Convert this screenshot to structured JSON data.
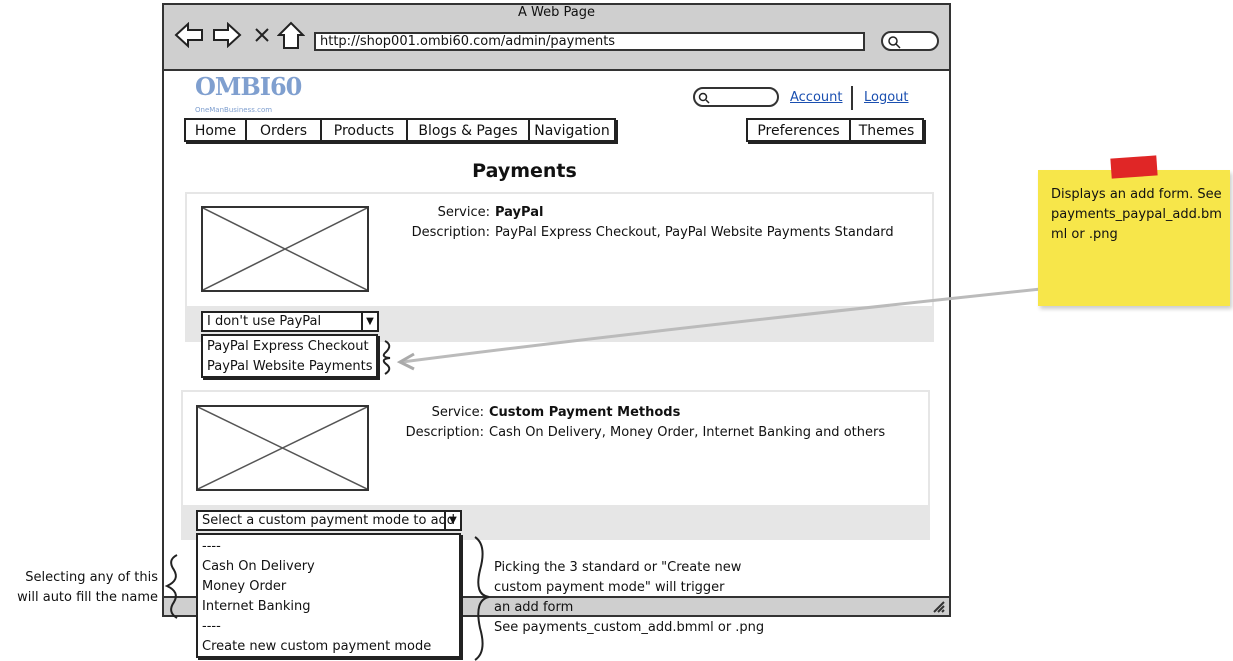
{
  "browser": {
    "title": "A Web Page",
    "url": "http://shop001.ombi60.com/admin/payments",
    "back_icon": "arrow-left-icon",
    "forward_icon": "arrow-right-icon",
    "stop_icon": "close-icon",
    "home_icon": "home-icon"
  },
  "header": {
    "logo_text": "OMBI60",
    "logo_subtext": "OneManBusiness.com",
    "account_link": "Account",
    "logout_link": "Logout",
    "main_tabs": [
      "Home",
      "Orders",
      "Products",
      "Blogs & Pages",
      "Navigation"
    ],
    "right_tabs": [
      "Preferences",
      "Themes"
    ]
  },
  "page": {
    "title": "Payments"
  },
  "paypal": {
    "service_label": "Service:",
    "service_value": "PayPal",
    "description_label": "Description:",
    "description_value": "PayPal Express Checkout, PayPal Website Payments Standard",
    "select_value": "I don't use PayPal",
    "options": [
      "PayPal Express Checkout",
      "PayPal Website Payments"
    ]
  },
  "custom": {
    "service_label": "Service:",
    "service_value": "Custom Payment Methods",
    "description_label": "Description:",
    "description_value": "Cash On Delivery, Money Order, Internet Banking and others",
    "select_value": "Select a custom payment mode to add",
    "options": [
      "----",
      "Cash On Delivery",
      "Money Order",
      "Internet Banking",
      "----",
      "Create new custom payment mode"
    ]
  },
  "notes": {
    "sticky": "Displays an add form. See payments_paypal_add.bmml or .png",
    "left_annotation_line1": "Selecting any of this",
    "left_annotation_line2": "will auto fill the name",
    "right_annotation_lines": [
      "Picking the 3 standard or \"Create new",
      "custom payment mode\" will trigger",
      "an add form",
      "See payments_custom_add.bmml or .png"
    ]
  },
  "colors": {
    "chrome": "#cfcfcf",
    "link": "#1a4fb0",
    "sticky": "#f7e64a",
    "tape": "#e02626",
    "strip": "#e6e6e6"
  }
}
